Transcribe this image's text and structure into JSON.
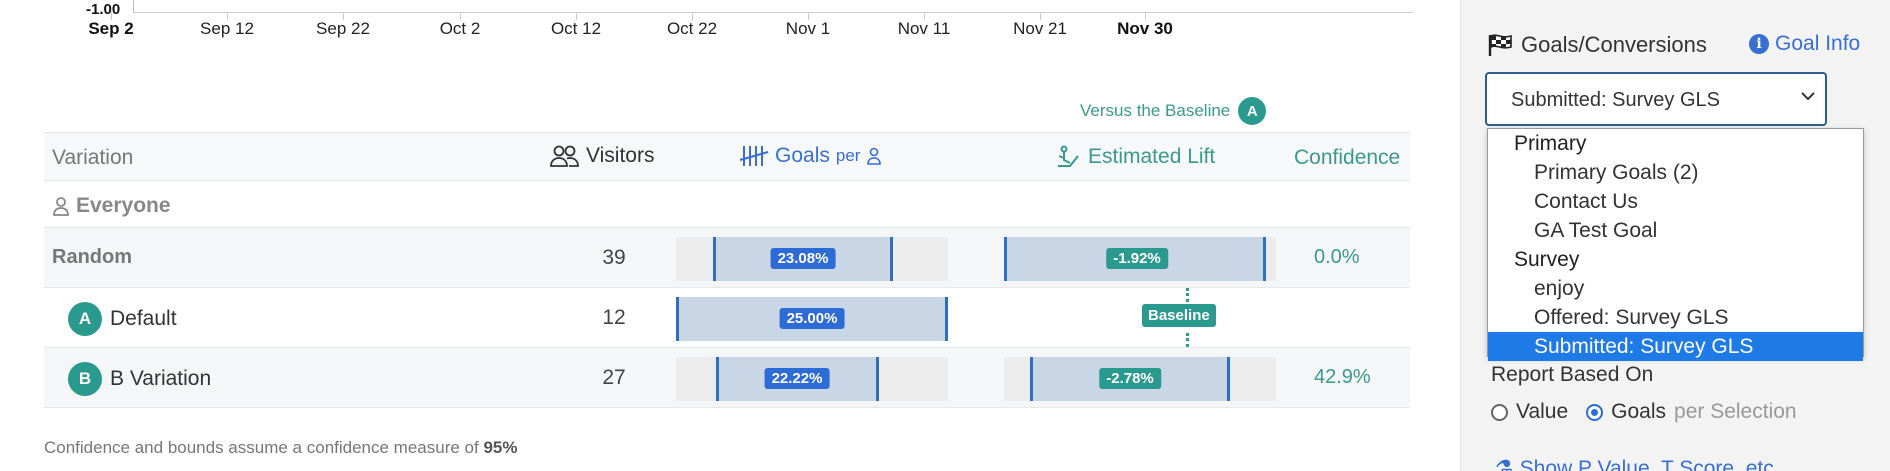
{
  "axis": {
    "ymin_label": "-1.00",
    "ticks": [
      "Sep 2",
      "Sep 12",
      "Sep 22",
      "Oct 2",
      "Oct 12",
      "Oct 22",
      "Nov 1",
      "Nov 11",
      "Nov 21",
      "Nov 30"
    ]
  },
  "versus": {
    "text": "Versus the Baseline",
    "badge": "A"
  },
  "table": {
    "headers": {
      "variation": "Variation",
      "visitors": "Visitors",
      "goals": "Goals",
      "goals_per": "per",
      "lift": "Estimated Lift",
      "confidence": "Confidence"
    },
    "segment": "Everyone",
    "rows": [
      {
        "name": "Random",
        "badge": "",
        "visitors": "39",
        "rate": "23.08%",
        "lift": "-1.92%",
        "confidence": "0.0%",
        "rate_value": 23.08,
        "lift_value": -1.92
      },
      {
        "name": "Default",
        "badge": "A",
        "visitors": "12",
        "rate": "25.00%",
        "lift": "Baseline",
        "confidence": "",
        "rate_value": 25.0,
        "lift_value": 0
      },
      {
        "name": "B Variation",
        "badge": "B",
        "visitors": "27",
        "rate": "22.22%",
        "lift": "-2.78%",
        "confidence": "42.9%",
        "rate_value": 22.22,
        "lift_value": -2.78
      }
    ]
  },
  "footnote": {
    "text": "Confidence and bounds assume a confidence measure of",
    "value": "95%"
  },
  "panel": {
    "title": "Goals/Conversions",
    "goal_info": "Goal Info",
    "selected": "Submitted: Survey GLS",
    "options": [
      {
        "type": "group",
        "label": "Primary"
      },
      {
        "type": "item",
        "label": "Primary Goals (2)"
      },
      {
        "type": "item",
        "label": "Contact Us"
      },
      {
        "type": "item",
        "label": "GA Test Goal"
      },
      {
        "type": "group",
        "label": "Survey"
      },
      {
        "type": "item",
        "label": "enjoy"
      },
      {
        "type": "item",
        "label": "Offered: Survey GLS"
      },
      {
        "type": "item",
        "label": "Submitted: Survey GLS",
        "selected": true
      }
    ],
    "report_based_on": "Report Based On",
    "radio_value": "Value",
    "radio_goals": "Goals",
    "radio_goals_suffix": "per Selection",
    "show_p": "Show P Value, T Score, etc"
  },
  "colors": {
    "teal": "#2b9a8e",
    "blue": "#2d6bd6",
    "select_highlight": "#1e7ae6"
  }
}
